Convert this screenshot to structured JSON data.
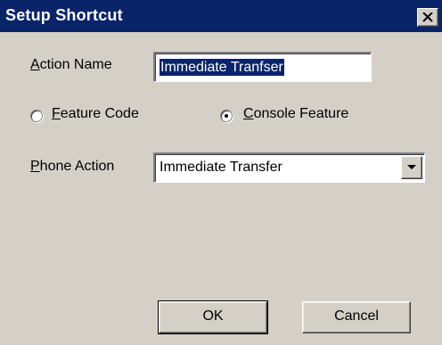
{
  "dialog": {
    "title": "Setup Shortcut",
    "close_icon": "close-icon"
  },
  "form": {
    "action_name": {
      "label": "Action Name",
      "mnemonic": "A",
      "label_rest": "ction Name",
      "value": "Immediate Tranfser"
    },
    "action_type": {
      "options": [
        {
          "label": "Feature Code",
          "mnemonic": "F",
          "label_rest": "eature Code",
          "selected": false
        },
        {
          "label": "Console Feature",
          "mnemonic": "C",
          "label_rest": "onsole Feature",
          "selected": true
        }
      ]
    },
    "phone_action": {
      "label": "Phone Action",
      "mnemonic": "P",
      "label_rest": "hone Action",
      "value": "Immediate Transfer",
      "dropdown_icon": "chevron-down-icon"
    }
  },
  "buttons": {
    "ok": "OK",
    "cancel": "Cancel"
  },
  "colors": {
    "titlebar": "#0a246a",
    "face": "#d4d0c8",
    "selection": "#0a246a"
  }
}
